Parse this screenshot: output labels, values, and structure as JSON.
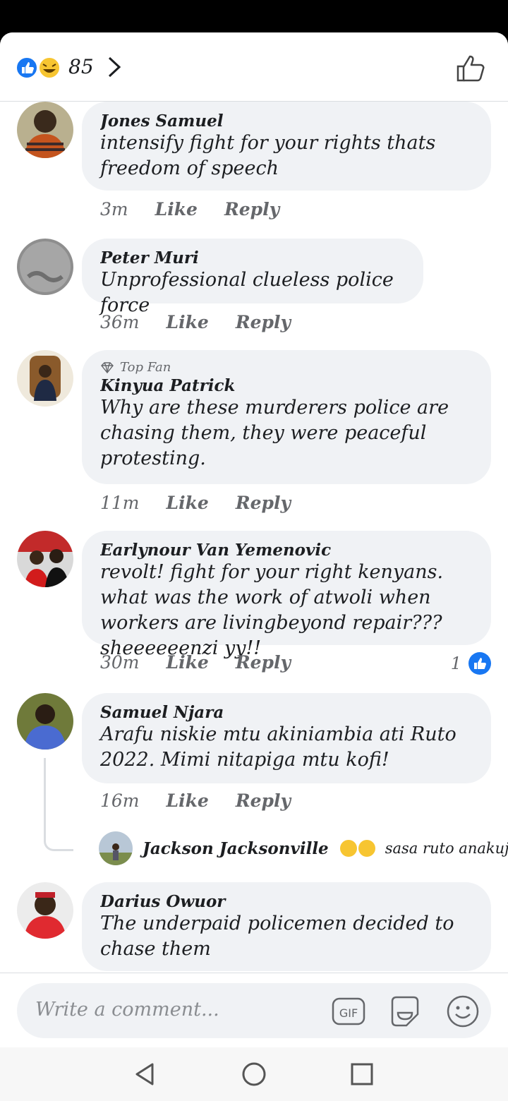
{
  "header": {
    "reaction_count": "85"
  },
  "comments": [
    {
      "author": "Jones Samuel",
      "text": "intensify fight for your rights thats freedom of speech",
      "time": "3m",
      "like_label": "Like",
      "reply_label": "Reply"
    },
    {
      "author": "Peter Muri",
      "text": "Unprofessional clueless police force",
      "time": "36m",
      "like_label": "Like",
      "reply_label": "Reply"
    },
    {
      "badge": "Top Fan",
      "author": "Kinyua Patrick",
      "text": "Why are these murderers police are chasing them, they were peaceful protesting.",
      "time": "11m",
      "like_label": "Like",
      "reply_label": "Reply"
    },
    {
      "author": "Earlynour Van Yemenovic",
      "text": "revolt! fight for your right kenyans. what was the work of atwoli when workers are livingbeyond repair??? sheeeeeenzi yy!!",
      "time": "30m",
      "like_label": "Like",
      "reply_label": "Reply",
      "likes": "1"
    },
    {
      "author": "Samuel Njara",
      "text": "Arafu niskie mtu akiniambia ati Ruto 2022. Mimi nitapiga mtu kofi!",
      "time": "16m",
      "like_label": "Like",
      "reply_label": "Reply",
      "reply_preview": {
        "author": "Jackson Jacksonville",
        "text": "sasa ruto anakuji..."
      }
    },
    {
      "author": "Darius Owuor",
      "text": "The underpaid policemen decided to chase them"
    }
  ],
  "composer": {
    "placeholder": "Write a comment...",
    "gif_label": "GIF"
  },
  "colors": {
    "accent": "#1877f2",
    "bubble": "#f0f2f5",
    "meta_text": "#65676b"
  }
}
